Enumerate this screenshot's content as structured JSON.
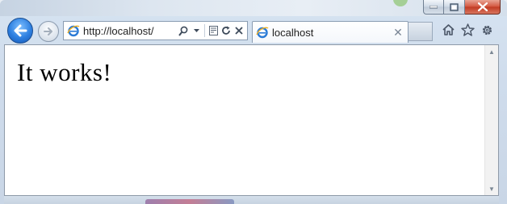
{
  "window": {
    "minimize_label": "",
    "maximize_label": "",
    "close_label": ""
  },
  "navigation": {
    "back_icon": "back-arrow-icon",
    "forward_icon": "forward-arrow-icon"
  },
  "address_bar": {
    "url": "http://localhost/",
    "search_icon": "search-icon",
    "dropdown_icon": "chevron-down-icon",
    "compat_icon": "compatibility-view-icon",
    "refresh_icon": "refresh-icon",
    "stop_icon": "close-icon"
  },
  "tabs": [
    {
      "label": "localhost",
      "active": true
    }
  ],
  "toolbar": {
    "home_icon": "home-icon",
    "favorites_icon": "star-icon",
    "tools_icon": "gear-icon"
  },
  "page": {
    "heading": "It works!"
  },
  "colors": {
    "accent_blue": "#2d7fe0",
    "close_red": "#c03a22",
    "frame": "#cfdcec"
  }
}
